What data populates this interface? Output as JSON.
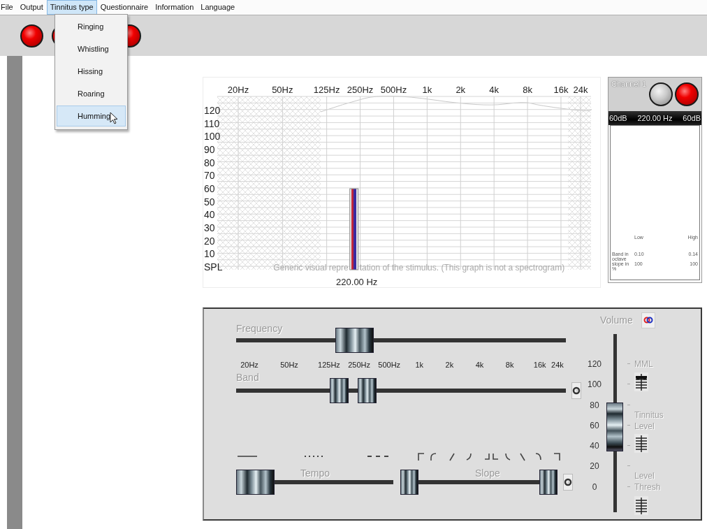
{
  "menu": [
    {
      "label": "File",
      "selected": false
    },
    {
      "label": "Output",
      "selected": false
    },
    {
      "label": "Tinnitus type",
      "selected": true
    },
    {
      "label": "Questionnaire",
      "selected": false
    },
    {
      "label": "Information",
      "selected": false
    },
    {
      "label": "Language",
      "selected": false
    }
  ],
  "dropdown": {
    "items": [
      {
        "label": "Ringing",
        "selected": false
      },
      {
        "label": "Whistling",
        "selected": false
      },
      {
        "label": "Hissing",
        "selected": false
      },
      {
        "label": "Roaring",
        "selected": false
      },
      {
        "label": "Humming",
        "selected": true
      }
    ]
  },
  "toolbar": {
    "lamps": [
      {
        "on": true
      },
      {
        "on": true
      },
      {
        "on": true
      }
    ]
  },
  "chart": {
    "chart_data": {
      "type": "bar",
      "categories": [
        "220.00 Hz"
      ],
      "values": [
        60
      ],
      "ylim": [
        0,
        120
      ],
      "grid": true,
      "yticks": [
        {
          "value": 0,
          "label": "SPL"
        },
        10,
        20,
        30,
        40,
        50,
        60,
        70,
        80,
        90,
        100,
        110,
        120
      ]
    },
    "frequency_axis": [
      "20Hz",
      "50Hz",
      "125Hz",
      "250Hz",
      "500Hz",
      "1k",
      "2k",
      "4k",
      "8k",
      "16k",
      "24k"
    ],
    "note": [
      "Generic visual repre",
      "tation of the stimulus. (This graph is not a spectrogram)"
    ]
  },
  "channel": {
    "title": "Channel 1",
    "lamps": [
      {
        "on": false
      },
      {
        "on": true
      }
    ],
    "left_level": "60dB",
    "frequency": "220.00 Hz",
    "right_level": "60dB",
    "columns": [
      "Low",
      "High"
    ],
    "rows": [
      {
        "label": "Band in octave",
        "low": "0.10",
        "high": "0.14"
      },
      {
        "label": "slope in %",
        "low": "100",
        "high": "100"
      }
    ]
  },
  "controls": {
    "frequency": {
      "label": "Frequency",
      "level": 0.34
    },
    "scale": [
      "20Hz",
      "50Hz",
      "125Hz",
      "250Hz",
      "500Hz",
      "1k",
      "2k",
      "4k",
      "8k",
      "16k",
      "24k"
    ],
    "band": {
      "label": "Band",
      "thumbs": [
        {
          "level": 0.3
        },
        {
          "level": 0.39
        }
      ]
    },
    "tempo": {
      "label": "Tempo",
      "level": 0
    },
    "slope": {
      "label": "Slope",
      "thumbs": [
        {
          "level": 0
        },
        {
          "level": 1
        }
      ]
    },
    "volume": {
      "label": "Volume",
      "level": 0.47,
      "scale": [
        "120",
        "100",
        "80",
        "60",
        "40",
        "20",
        "0"
      ],
      "markers": [
        "MML",
        "Tinnitus Level",
        "Level Thresh"
      ]
    }
  }
}
